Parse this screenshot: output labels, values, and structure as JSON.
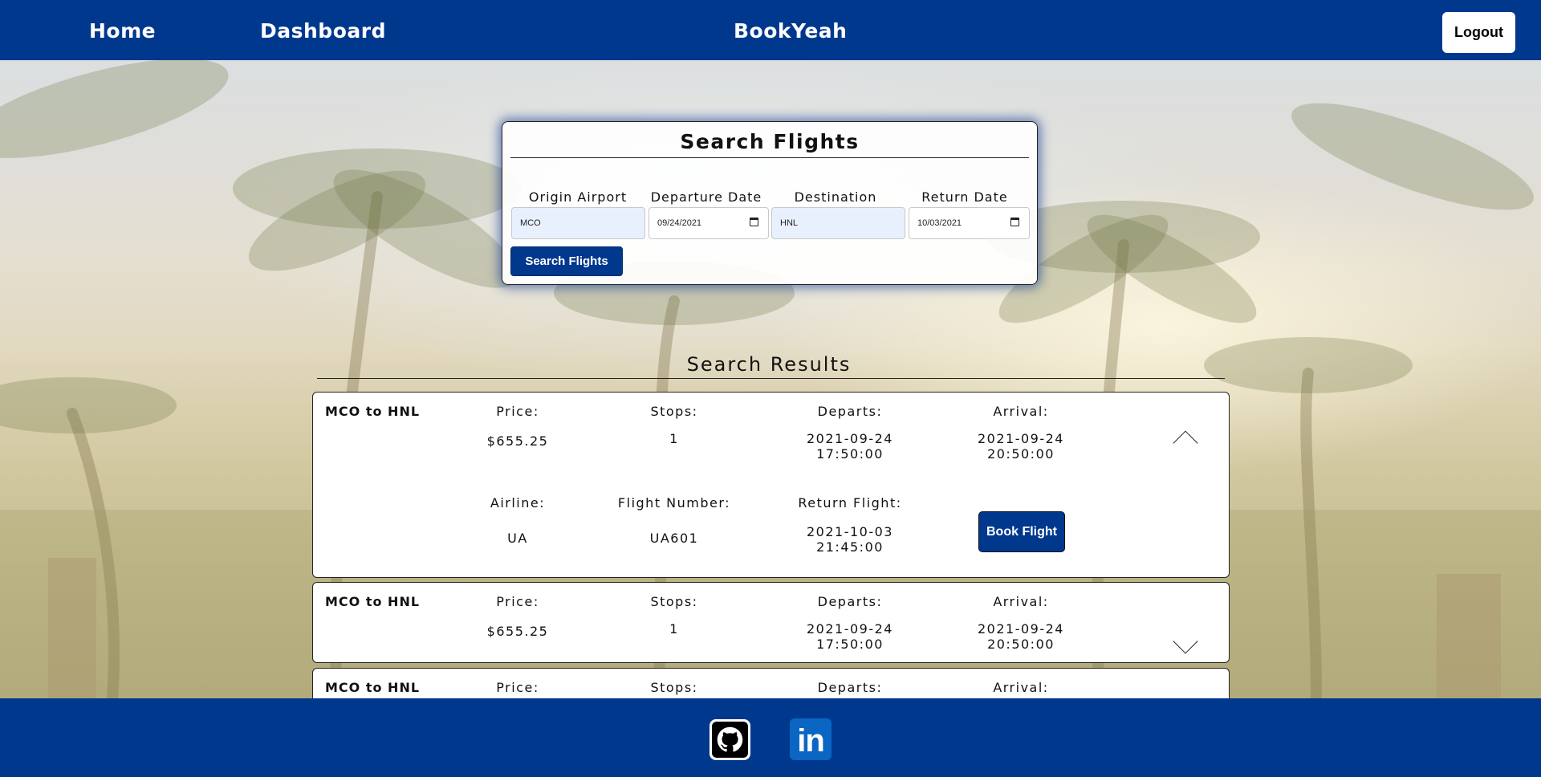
{
  "nav": {
    "home": "Home",
    "dashboard": "Dashboard",
    "brand": "BookYeah",
    "logout": "Logout"
  },
  "search": {
    "title": "Search Flights",
    "origin_label": "Origin Airport",
    "origin_value": "MCO",
    "departure_label": "Departure Date",
    "departure_value": "09/24/2021",
    "destination_label": "Destination Airport",
    "destination_value": "HNL",
    "return_label": "Return Date",
    "return_value": "10/03/2021",
    "button": "Search Flights"
  },
  "results": {
    "title": "Search Results",
    "labels": {
      "price": "Price:",
      "stops": "Stops:",
      "departs": "Departs:",
      "arrival": "Arrival:",
      "airline": "Airline:",
      "flight_number": "Flight Number:",
      "return_flight": "Return Flight:",
      "book": "Book Flight"
    },
    "cards": [
      {
        "route": "MCO to HNL",
        "price": "$655.25",
        "stops": "1",
        "departs_date": "2021-09-24",
        "departs_time": "17:50:00",
        "arrival_date": "2021-09-24",
        "arrival_time": "20:50:00",
        "airline": "UA",
        "flight_number": "UA601",
        "return_date": "2021-10-03",
        "return_time": "21:45:00",
        "expanded": true
      },
      {
        "route": "MCO to HNL",
        "price": "$655.25",
        "stops": "1",
        "departs_date": "2021-09-24",
        "departs_time": "17:50:00",
        "arrival_date": "2021-09-24",
        "arrival_time": "20:50:00",
        "expanded": false
      },
      {
        "route": "MCO to HNL",
        "expanded": false
      }
    ]
  },
  "footer": {
    "icons": [
      "github-icon",
      "linkedin-icon"
    ],
    "linkedin_glyph": "in"
  },
  "colors": {
    "primary": "#00388e",
    "panel_glow": "#002d8c",
    "airport_field": "#e8f0fe",
    "linkedin": "#0a66c2"
  }
}
